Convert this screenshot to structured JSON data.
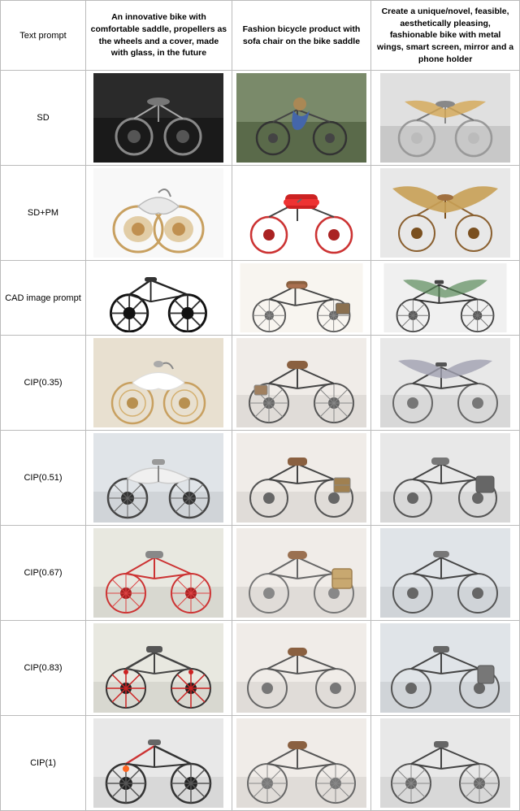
{
  "table": {
    "headers": {
      "col0": "Text prompt",
      "col1": "An innovative bike with comfortable saddle, propellers as the wheels and a cover, made with glass, in the future",
      "col2": "Fashion bicycle product with sofa chair on the bike saddle",
      "col3": "Create a unique/novel, feasible, aesthetically pleasing, fashionable bike with metal wings, smart screen, mirror and a phone holder"
    },
    "rows": [
      {
        "label": "SD",
        "type": "sd"
      },
      {
        "label": "SD+PM",
        "type": "sdpm"
      },
      {
        "label": "CAD image prompt",
        "type": "cad"
      },
      {
        "label": "CIP(0.35)",
        "type": "cip035"
      },
      {
        "label": "CIP(0.51)",
        "type": "cip051"
      },
      {
        "label": "CIP(0.67)",
        "type": "cip067"
      },
      {
        "label": "CIP(0.83)",
        "type": "cip083"
      },
      {
        "label": "CIP(1)",
        "type": "cip1"
      }
    ]
  }
}
